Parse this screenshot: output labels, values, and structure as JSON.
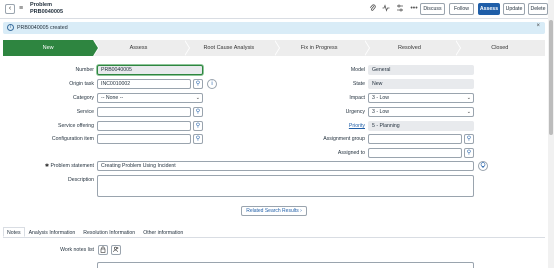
{
  "header": {
    "title": "Problem",
    "number": "PRB0040005",
    "buttons": [
      "Discuss",
      "Follow",
      "Assess",
      "Update",
      "Delete"
    ],
    "icons": [
      "paperclip-icon",
      "pulse-icon",
      "settings-sliders-icon",
      "more-icon"
    ]
  },
  "info": {
    "message": "PRB0040005 created"
  },
  "flow": {
    "steps": [
      "New",
      "Assess",
      "Root Cause Analysis",
      "Fix in Progress",
      "Resolved",
      "Closed"
    ],
    "active": "New"
  },
  "form": {
    "number_label": "Number",
    "number_value": "PRB0040005",
    "origin_task_label": "Origin task",
    "origin_task_value": "INC0010002",
    "category_label": "Category",
    "category_value": "-- None --",
    "service_label": "Service",
    "service_value": "",
    "service_offering_label": "Service offering",
    "service_offering_value": "",
    "config_item_label": "Configuration item",
    "config_item_value": "",
    "model_label": "Model",
    "model_value": "General",
    "state_label": "State",
    "state_value": "New",
    "impact_label": "Impact",
    "impact_value": "3 - Low",
    "urgency_label": "Urgency",
    "urgency_value": "3 - Low",
    "priority_label": "Priority",
    "priority_value": "5 - Planning",
    "assignment_group_label": "Assignment group",
    "assignment_group_value": "",
    "assigned_to_label": "Assigned to",
    "assigned_to_value": "",
    "problem_statement_label": "Problem statement",
    "problem_statement_value": "Creating Problem Using Incident",
    "description_label": "Description",
    "description_value": "",
    "related_search": "Related Search Results"
  },
  "tabs": [
    "Notes",
    "Analysis Information",
    "Resolution Information",
    "Other information"
  ],
  "notes": {
    "work_notes_list_label": "Work notes list"
  }
}
